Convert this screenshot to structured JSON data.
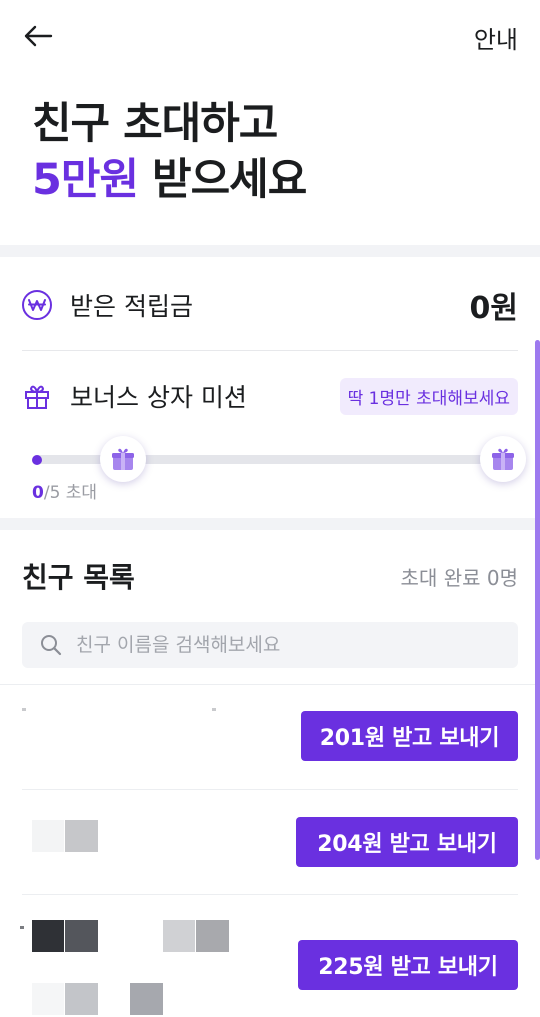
{
  "header": {
    "guide_label": "안내"
  },
  "hero": {
    "line1": "친구 초대하고",
    "amount": "5만원",
    "line2_rest": " 받으세요"
  },
  "points": {
    "label": "받은 적립금",
    "value": "0원"
  },
  "mission": {
    "label": "보너스 상자 미션",
    "badge": "딱 1명만 초대해보세요",
    "progress_current": "0",
    "progress_rest": "/5 초대",
    "progress_fraction": 0
  },
  "friends": {
    "title": "친구 목록",
    "completed": "초대 완료 0명",
    "search_placeholder": "친구 이름을 검색해보세요",
    "items": [
      {
        "button": "201원 받고 보내기"
      },
      {
        "button": "204원 받고 보내기"
      },
      {
        "button": "225원 받고 보내기"
      }
    ]
  },
  "colors": {
    "accent": "#6a30e0",
    "badge_bg": "#f1ebfd",
    "section_gap": "#f2f3f6"
  },
  "icons": {
    "back": "arrow-left-icon",
    "won": "won-coin-icon",
    "gift": "gift-icon",
    "search": "search-icon",
    "gift_box": "gift-box-icon"
  }
}
